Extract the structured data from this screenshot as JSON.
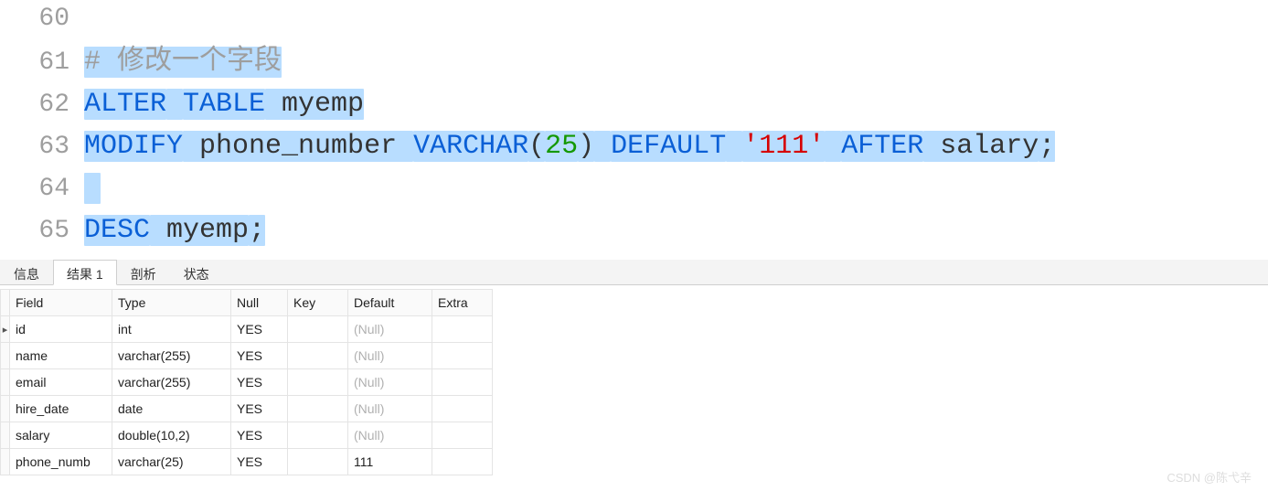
{
  "code": {
    "lines": [
      {
        "num": "60",
        "parts": []
      },
      {
        "num": "61",
        "parts": [
          {
            "cls": "t-comment",
            "text": "# 修改一个字段",
            "sel": true
          }
        ]
      },
      {
        "num": "62",
        "parts": [
          {
            "cls": "t-keyword",
            "text": "ALTER",
            "sel": true
          },
          {
            "cls": "t-plain",
            "text": " ",
            "sel": true
          },
          {
            "cls": "t-keyword",
            "text": "TABLE",
            "sel": true
          },
          {
            "cls": "t-plain",
            "text": " myemp",
            "sel": true
          }
        ]
      },
      {
        "num": "63",
        "parts": [
          {
            "cls": "t-keyword",
            "text": "MODIFY",
            "sel": true
          },
          {
            "cls": "t-plain",
            "text": " phone_number ",
            "sel": true
          },
          {
            "cls": "t-keyword",
            "text": "VARCHAR",
            "sel": true
          },
          {
            "cls": "t-paren",
            "text": "(",
            "sel": true
          },
          {
            "cls": "t-num",
            "text": "25",
            "sel": true
          },
          {
            "cls": "t-paren",
            "text": ")",
            "sel": true
          },
          {
            "cls": "t-plain",
            "text": " ",
            "sel": true
          },
          {
            "cls": "t-keyword",
            "text": "DEFAULT",
            "sel": true
          },
          {
            "cls": "t-plain",
            "text": " ",
            "sel": true
          },
          {
            "cls": "t-string",
            "text": "'111'",
            "sel": true
          },
          {
            "cls": "t-plain",
            "text": " ",
            "sel": true
          },
          {
            "cls": "t-keyword",
            "text": "AFTER",
            "sel": true
          },
          {
            "cls": "t-plain",
            "text": " salary",
            "sel": true
          },
          {
            "cls": "t-semic",
            "text": ";",
            "sel": true
          }
        ]
      },
      {
        "num": "64",
        "parts": [
          {
            "cls": "t-plain",
            "text": " ",
            "sel": true
          }
        ]
      },
      {
        "num": "65",
        "parts": [
          {
            "cls": "t-keyword",
            "text": "DESC",
            "sel": true
          },
          {
            "cls": "t-plain",
            "text": " myemp",
            "sel": true
          },
          {
            "cls": "t-semic",
            "text": ";",
            "sel": true
          }
        ]
      }
    ]
  },
  "tabs": {
    "items": [
      {
        "label": "信息",
        "active": false
      },
      {
        "label": "结果 1",
        "active": true
      },
      {
        "label": "剖析",
        "active": false
      },
      {
        "label": "状态",
        "active": false
      }
    ]
  },
  "grid": {
    "headers": [
      "Field",
      "Type",
      "Null",
      "Key",
      "Default",
      "Extra"
    ],
    "rows": [
      {
        "current": true,
        "cells": [
          "id",
          "int",
          "YES",
          "",
          {
            "null": true,
            "text": "(Null)"
          },
          ""
        ]
      },
      {
        "current": false,
        "cells": [
          "name",
          "varchar(255)",
          "YES",
          "",
          {
            "null": true,
            "text": "(Null)"
          },
          ""
        ]
      },
      {
        "current": false,
        "cells": [
          "email",
          "varchar(255)",
          "YES",
          "",
          {
            "null": true,
            "text": "(Null)"
          },
          ""
        ]
      },
      {
        "current": false,
        "cells": [
          "hire_date",
          "date",
          "YES",
          "",
          {
            "null": true,
            "text": "(Null)"
          },
          ""
        ]
      },
      {
        "current": false,
        "cells": [
          "salary",
          "double(10,2)",
          "YES",
          "",
          {
            "null": true,
            "text": "(Null)"
          },
          ""
        ]
      },
      {
        "current": false,
        "cells": [
          "phone_numb",
          "varchar(25)",
          "YES",
          "",
          "111",
          ""
        ]
      }
    ]
  },
  "watermark": "CSDN @陈弋辛"
}
